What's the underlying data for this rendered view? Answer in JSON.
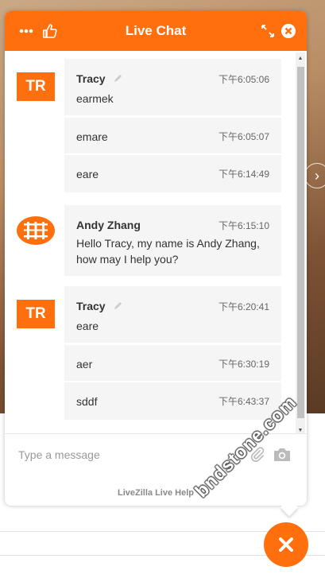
{
  "header": {
    "title": "Live Chat",
    "accent": "#ff6f0e"
  },
  "messages": [
    {
      "author": "Tracy",
      "avatar": "TR",
      "items": [
        {
          "time": "下午6:05:06",
          "text": "earmek"
        },
        {
          "time": "下午6:05:07",
          "text": "emare"
        },
        {
          "time": "下午6:14:49",
          "text": "eare"
        }
      ]
    },
    {
      "author": "Andy Zhang",
      "avatar_icon": "operator-logo-icon",
      "items": [
        {
          "time": "下午6:15:10",
          "text_line1": "Hello Tracy, my name is Andy Zhang,",
          "text_line2": "how may I help you?"
        }
      ]
    },
    {
      "author": "Tracy",
      "avatar": "TR",
      "items": [
        {
          "time": "下午6:20:41",
          "text": "eare"
        },
        {
          "time": "下午6:30:19",
          "text": "aer"
        },
        {
          "time": "下午6:43:37",
          "text": "sddf"
        }
      ]
    }
  ],
  "input": {
    "placeholder": "Type a message"
  },
  "footer": {
    "powered_by": "LiveZilla Live Help"
  },
  "watermark": "bndstone.com"
}
